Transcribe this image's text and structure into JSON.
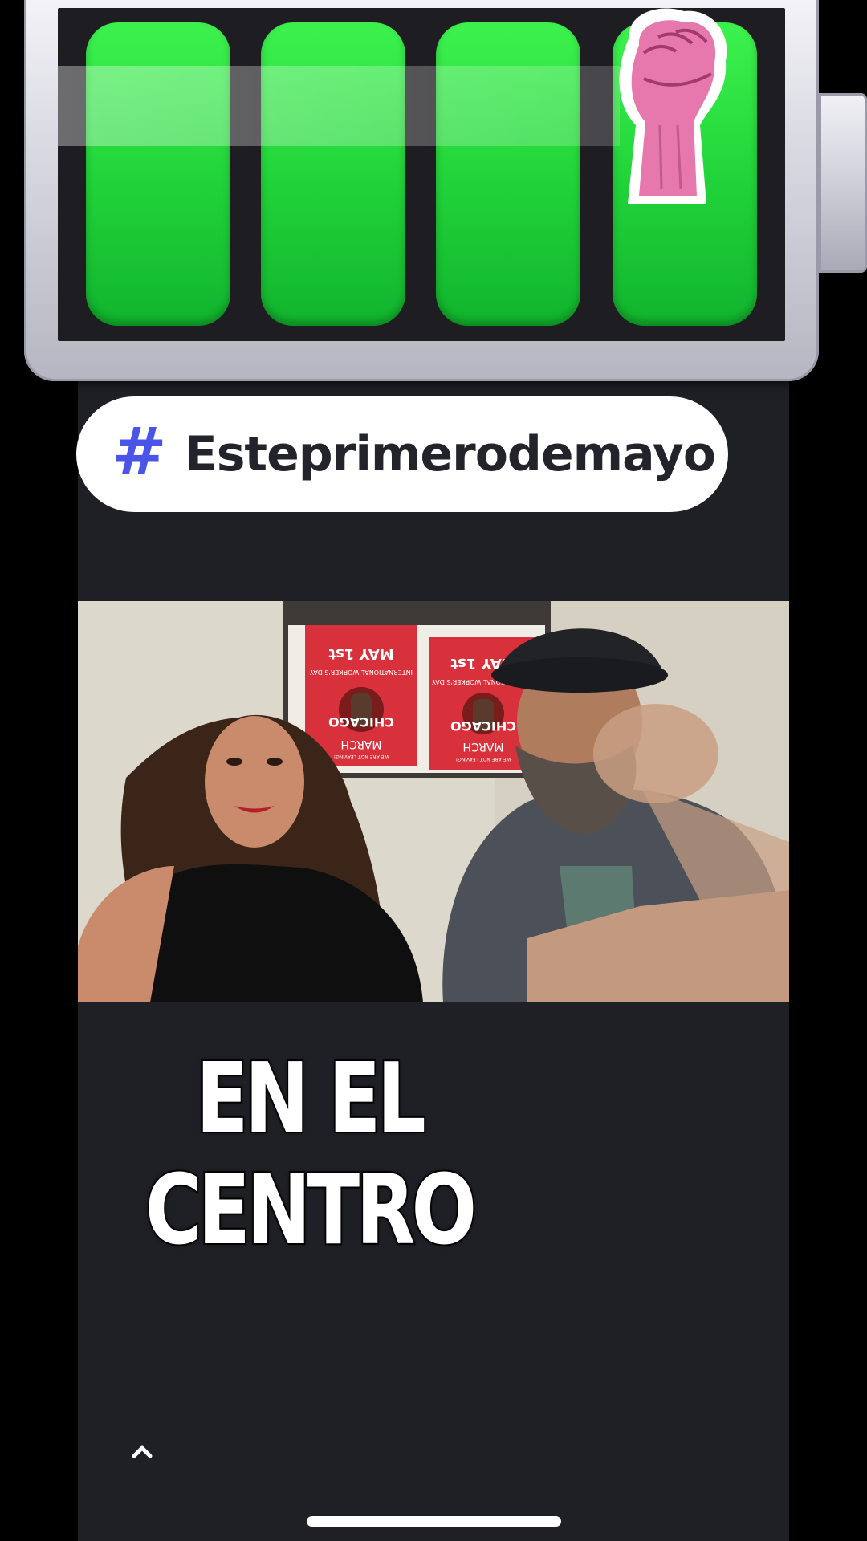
{
  "sticker": {
    "hashtag_symbol": "#",
    "hashtag_text": "Esteprimerodemayo",
    "battery_level": 1.0,
    "battery_cells": 4
  },
  "video": {
    "posters": [
      {
        "title": "MAY 1st",
        "subtitle": "INTERNATIONAL WORKER'S DAY",
        "city": "CHICAGO",
        "event": "MARCH",
        "tagline": "WE ARE NOT LEAVING!"
      },
      {
        "title": "MAY 1st",
        "subtitle": "INTERNATIONAL WORKER'S DAY",
        "city": "CHICAGO",
        "event": "MARCH",
        "tagline": "WE ARE NOT LEAVING!"
      }
    ]
  },
  "caption": {
    "text": "EN EL CENTRO"
  },
  "controls": {
    "expand_icon": "chevron-up-icon"
  },
  "colors": {
    "battery_green": "#22d53a",
    "hashtag_accent": "#4a55e8",
    "column_background": "#1f2026",
    "poster_red": "#d8313b"
  }
}
